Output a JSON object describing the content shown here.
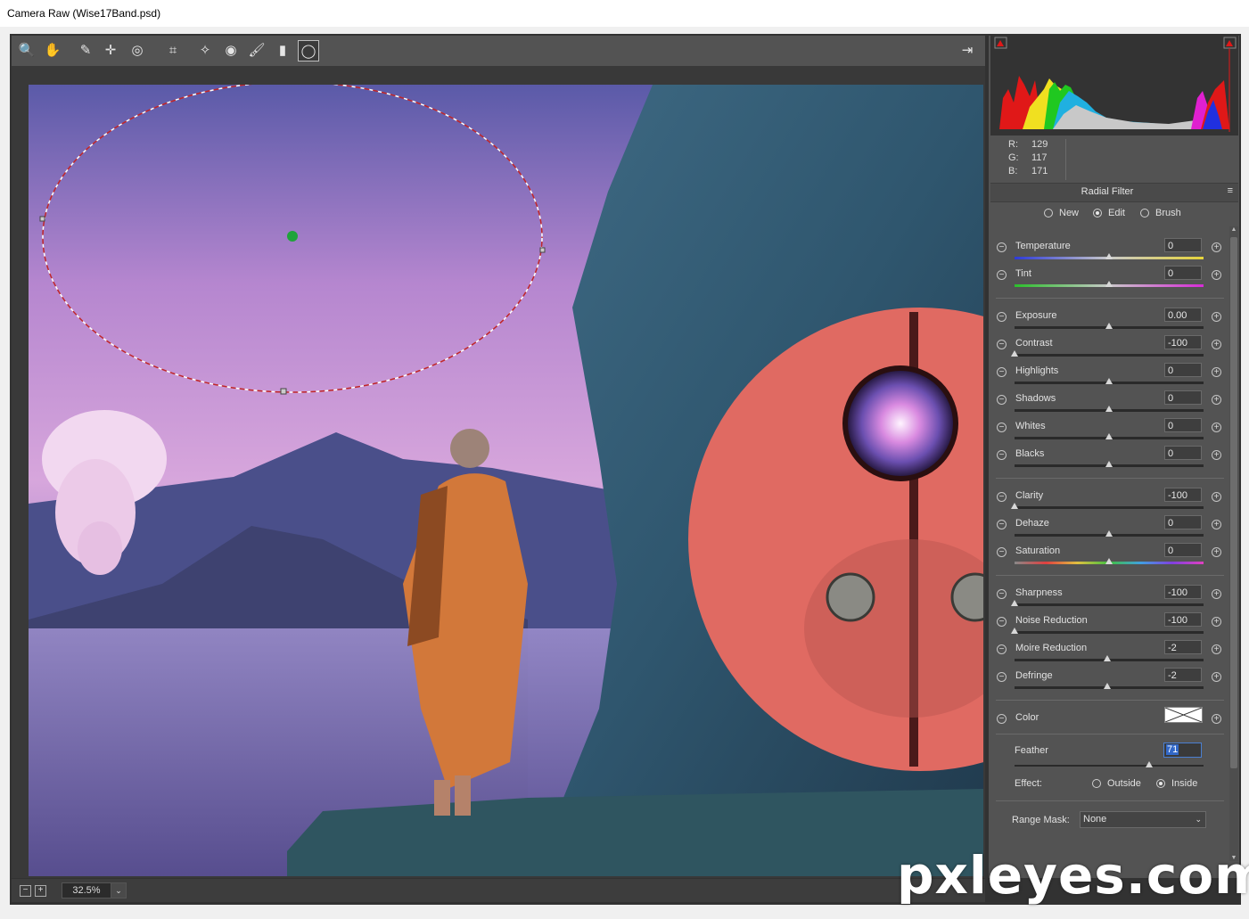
{
  "window": {
    "title": "Camera Raw (Wise17Band.psd)"
  },
  "toolbar": {
    "tools": [
      {
        "name": "zoom-tool",
        "glyph": "🔍"
      },
      {
        "name": "hand-tool",
        "glyph": "✋"
      },
      {
        "name": "white-balance-tool",
        "glyph": "✎"
      },
      {
        "name": "color-sampler-tool",
        "glyph": "✛"
      },
      {
        "name": "targeted-adjustment-tool",
        "glyph": "◎"
      },
      {
        "name": "transform-tool",
        "glyph": "⌗"
      },
      {
        "name": "spot-removal-tool",
        "glyph": "✧"
      },
      {
        "name": "red-eye-tool",
        "glyph": "◉"
      },
      {
        "name": "adjustment-brush-tool",
        "glyph": "🖌"
      },
      {
        "name": "graduated-filter-tool",
        "glyph": "▮"
      },
      {
        "name": "radial-filter-tool",
        "glyph": "◯"
      }
    ],
    "export_glyph": "⇥"
  },
  "status": {
    "zoom": "32.5%",
    "zoom_out": "−",
    "zoom_in": "+",
    "dropdown": "⌄"
  },
  "readout": {
    "r_label": "R:",
    "r": "129",
    "g_label": "G:",
    "g": "117",
    "b_label": "B:",
    "b": "171"
  },
  "panel": {
    "title": "Radial Filter",
    "menu_glyph": "≡",
    "modes": {
      "new": "New",
      "edit": "Edit",
      "brush": "Brush",
      "selected": "Edit"
    },
    "sliders": [
      {
        "label": "Temperature",
        "value": "0",
        "pos": 0.5
      },
      {
        "label": "Tint",
        "value": "0",
        "pos": 0.5
      },
      {
        "label": "Exposure",
        "value": "0.00",
        "pos": 0.5
      },
      {
        "label": "Contrast",
        "value": "-100",
        "pos": 0.0
      },
      {
        "label": "Highlights",
        "value": "0",
        "pos": 0.5
      },
      {
        "label": "Shadows",
        "value": "0",
        "pos": 0.5
      },
      {
        "label": "Whites",
        "value": "0",
        "pos": 0.5
      },
      {
        "label": "Blacks",
        "value": "0",
        "pos": 0.5
      },
      {
        "label": "Clarity",
        "value": "-100",
        "pos": 0.0
      },
      {
        "label": "Dehaze",
        "value": "0",
        "pos": 0.5
      },
      {
        "label": "Saturation",
        "value": "0",
        "pos": 0.5
      },
      {
        "label": "Sharpness",
        "value": "-100",
        "pos": 0.0
      },
      {
        "label": "Noise Reduction",
        "value": "-100",
        "pos": 0.0
      },
      {
        "label": "Moire Reduction",
        "value": "-2",
        "pos": 0.49
      },
      {
        "label": "Defringe",
        "value": "-2",
        "pos": 0.49
      }
    ],
    "color_label": "Color",
    "feather_label": "Feather",
    "feather_value": "71",
    "feather_pos": 0.71,
    "effect_label": "Effect:",
    "effect_outside": "Outside",
    "effect_inside": "Inside",
    "range_mask_label": "Range Mask:",
    "range_mask_value": "None"
  },
  "watermark": "pxleyes.com",
  "colors": {
    "panel_bg": "#535353",
    "frame_bg": "#323232",
    "highlight": "#3268c8"
  }
}
